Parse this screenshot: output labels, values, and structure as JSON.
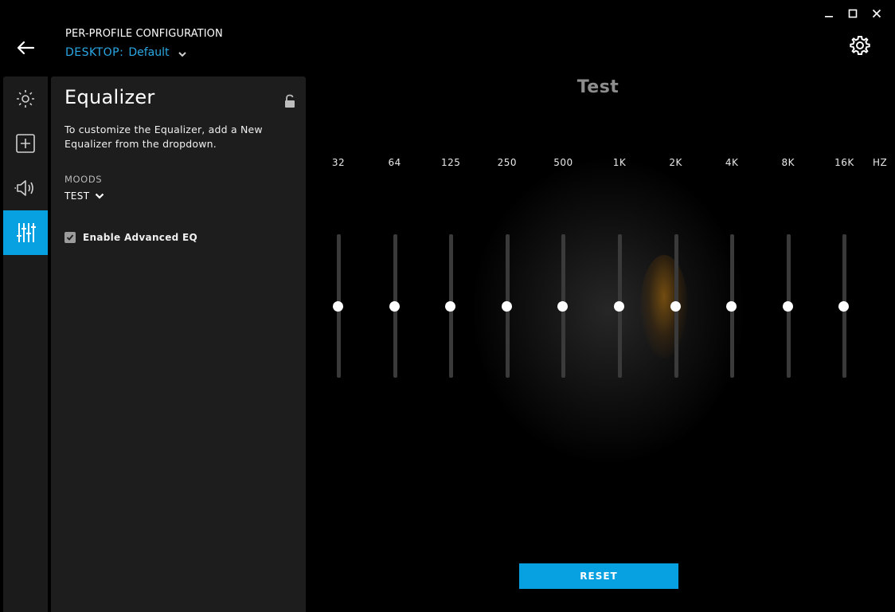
{
  "window": {
    "minimize_icon": "minimize-icon",
    "maximize_icon": "maximize-icon",
    "close_icon": "close-icon"
  },
  "header": {
    "title": "PER-PROFILE CONFIGURATION",
    "profile_prefix": "DESKTOP:",
    "profile_name": "Default"
  },
  "nav": {
    "items": [
      {
        "icon": "lighting-icon",
        "active": false
      },
      {
        "icon": "assignments-icon",
        "active": false
      },
      {
        "icon": "speaker-icon",
        "active": false
      },
      {
        "icon": "equalizer-icon",
        "active": true
      }
    ]
  },
  "panel": {
    "title": "Equalizer",
    "description": "To customize the Equalizer, add a New Equalizer from the dropdown.",
    "moods_label": "MOODS",
    "moods_value": "TEST",
    "advanced_eq_label": "Enable Advanced EQ",
    "advanced_eq_checked": true
  },
  "main": {
    "device_name": "Test",
    "unit_label": "HZ",
    "reset_label": "RESET"
  },
  "eq": {
    "bands": [
      {
        "label": "32",
        "gain": 0
      },
      {
        "label": "64",
        "gain": 0
      },
      {
        "label": "125",
        "gain": 0
      },
      {
        "label": "250",
        "gain": 0
      },
      {
        "label": "500",
        "gain": 0
      },
      {
        "label": "1K",
        "gain": 0
      },
      {
        "label": "2K",
        "gain": 0
      },
      {
        "label": "4K",
        "gain": 0
      },
      {
        "label": "8K",
        "gain": 0
      },
      {
        "label": "16K",
        "gain": 0
      }
    ]
  },
  "colors": {
    "accent": "#07a0e0",
    "panel": "#1d1d1d",
    "background": "#000000"
  }
}
